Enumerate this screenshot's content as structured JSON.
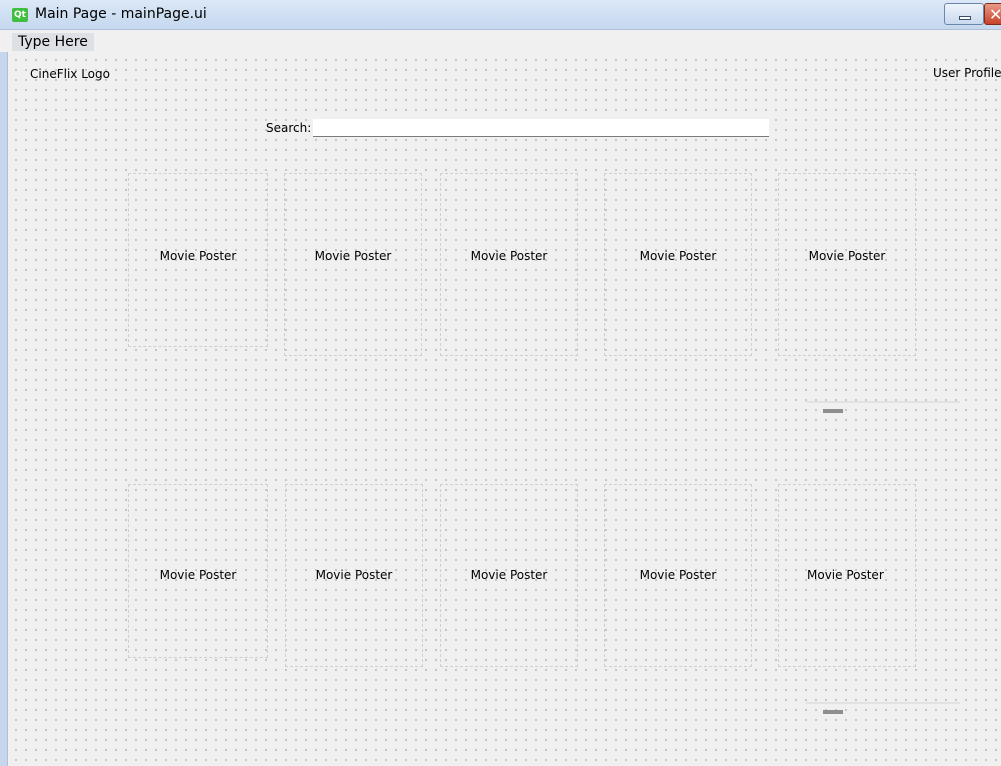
{
  "window": {
    "title": "Main Page - mainPage.ui",
    "app_icon": "Qt"
  },
  "menubar": {
    "items": [
      "Type Here"
    ]
  },
  "header": {
    "logo_label": "CineFlix Logo",
    "profile_label": "User Profile"
  },
  "search": {
    "label": "Search:",
    "value": "",
    "placeholder": ""
  },
  "rows": [
    {
      "posters": [
        "Movie Poster",
        "Movie Poster",
        "Movie Poster",
        "Movie Poster",
        "Movie Poster"
      ]
    },
    {
      "posters": [
        "Movie Poster",
        "Movie Poster",
        "Movie Poster",
        "Movie Poster",
        "Movie Poster"
      ]
    }
  ],
  "icons": {
    "app": "qt-logo-icon",
    "minimize": "minimize-icon",
    "close": "close-icon",
    "slider_handle": "slider-handle-icon"
  }
}
